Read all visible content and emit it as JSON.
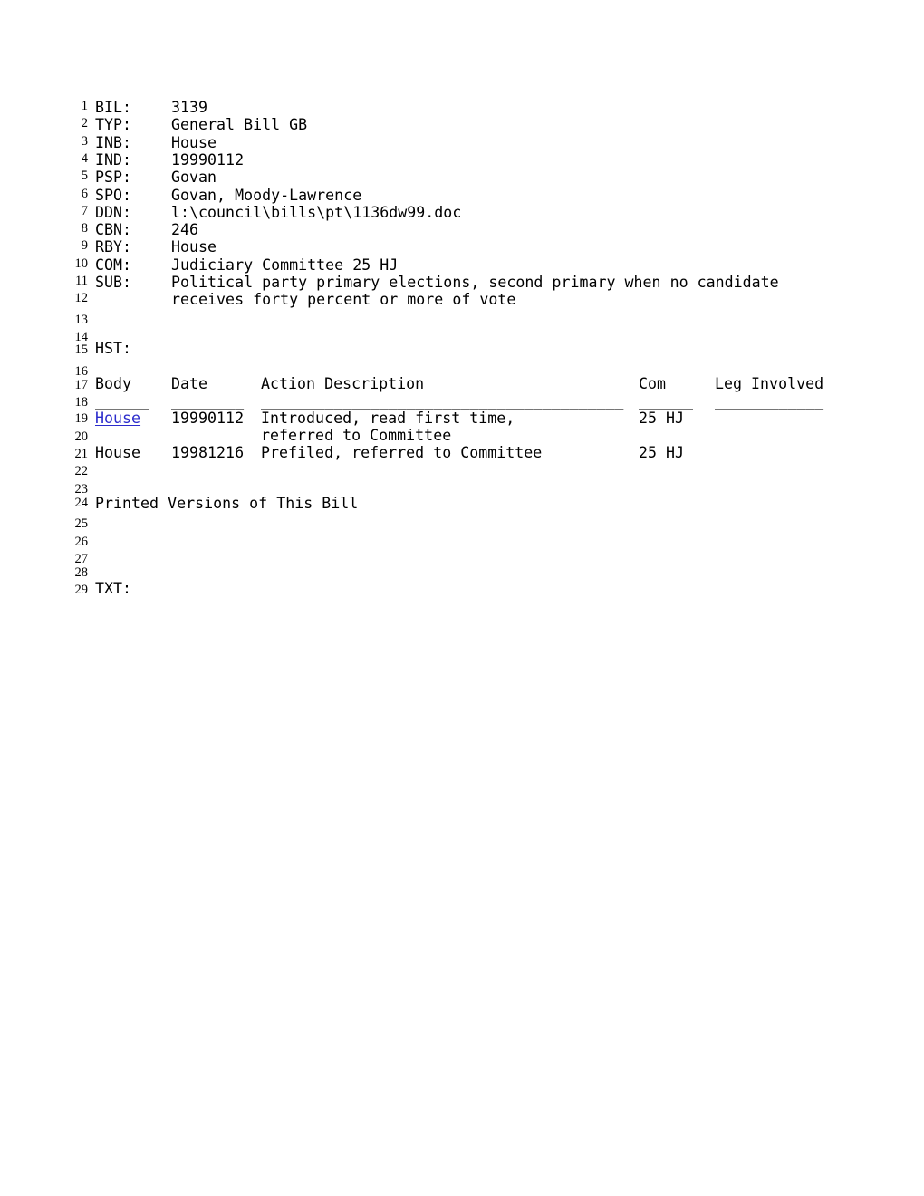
{
  "document": {
    "title": "Bill 3139 - General Bill GB",
    "background_color": "#ffffff",
    "text_color": "#000000",
    "link_color": "#2b2bcc"
  },
  "fields": {
    "bil_label": "BIL:",
    "bil_value": "3139",
    "typ_label": "TYP:",
    "typ_value": "General Bill GB",
    "inb_label": "INB:",
    "inb_value": "House",
    "ind_label": "IND:",
    "ind_value": "19990112",
    "psp_label": "PSP:",
    "psp_value": "Govan",
    "spo_label": "SPO:",
    "spo_value": "Govan, Moody-Lawrence",
    "ddn_label": "DDN:",
    "ddn_value": "l:\\council\\bills\\pt\\1136dw99.doc",
    "cbn_label": "CBN:",
    "cbn_value": "246",
    "rby_label": "RBY:",
    "rby_value": "House",
    "com_label": "COM:",
    "com_value": "Judiciary Committee 25 HJ",
    "sub_label": "SUB:",
    "sub_value_line1": "Political party primary elections, second primary when no candidate",
    "sub_value_line2": "receives forty percent or more of vote",
    "hst_label": "HST:",
    "txt_label": "TXT:"
  },
  "history_table": {
    "headers": {
      "body": "Body",
      "date": "Date",
      "action": "Action Description",
      "com": "Com",
      "leg": "Leg Involved"
    },
    "separator": {
      "body": "______",
      "date": "________",
      "action": "________________________________________",
      "com": "______",
      "leg": "____________"
    },
    "rows": [
      {
        "body": "House",
        "body_is_link": true,
        "date": "19990112",
        "action_line1": "Introduced, read first time,",
        "action_line2": "referred to Committee",
        "com": "25 HJ",
        "leg": ""
      },
      {
        "body": "House",
        "body_is_link": false,
        "date": "19981216",
        "action_line1": "Prefiled, referred to Committee",
        "action_line2": "",
        "com": "25 HJ",
        "leg": ""
      }
    ]
  },
  "sections": {
    "printed_versions": "Printed Versions of This Bill"
  },
  "line_numbers": [
    "1",
    "2",
    "3",
    "4",
    "5",
    "6",
    "7",
    "8",
    "9",
    "10",
    "11",
    "12",
    "13",
    "14",
    "15",
    "16",
    "17",
    "18",
    "19",
    "20",
    "21",
    "22",
    "23",
    "24",
    "25",
    "26",
    "27",
    "28",
    "29"
  ]
}
